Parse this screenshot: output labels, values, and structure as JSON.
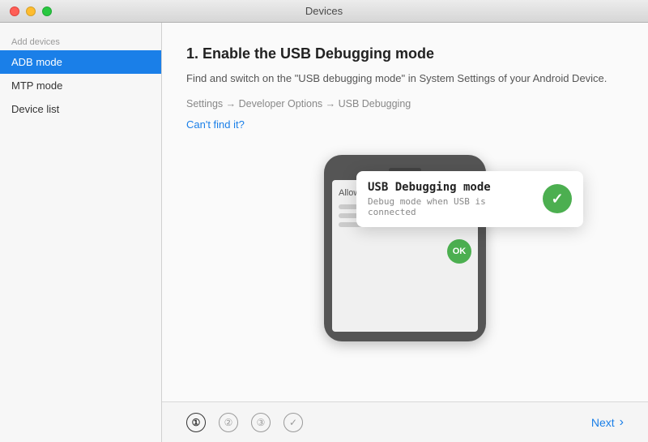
{
  "window": {
    "title": "Devices"
  },
  "sidebar": {
    "section_title": "Add devices",
    "items": [
      {
        "id": "adb-mode",
        "label": "ADB mode",
        "active": true
      },
      {
        "id": "mtp-mode",
        "label": "MTP mode",
        "active": false
      },
      {
        "id": "device-list",
        "label": "Device list",
        "active": false
      }
    ]
  },
  "content": {
    "step_title": "1. Enable the USB Debugging mode",
    "step_description": "Find and switch on the \"USB debugging mode\" in System Settings of your Android Device.",
    "step_path": "Settings → Developer Options → USB Debugging",
    "cant_find_label": "Can't find it?",
    "debug_card": {
      "title": "USB Debugging mode",
      "subtitle": "Debug mode when USB is connected"
    },
    "phone": {
      "allow_label": "Allow",
      "ok_label": "OK"
    }
  },
  "footer": {
    "steps": [
      {
        "label": "①",
        "type": "active"
      },
      {
        "label": "②",
        "type": "normal"
      },
      {
        "label": "③",
        "type": "normal"
      },
      {
        "label": "✓",
        "type": "check"
      }
    ],
    "next_label": "Next"
  }
}
